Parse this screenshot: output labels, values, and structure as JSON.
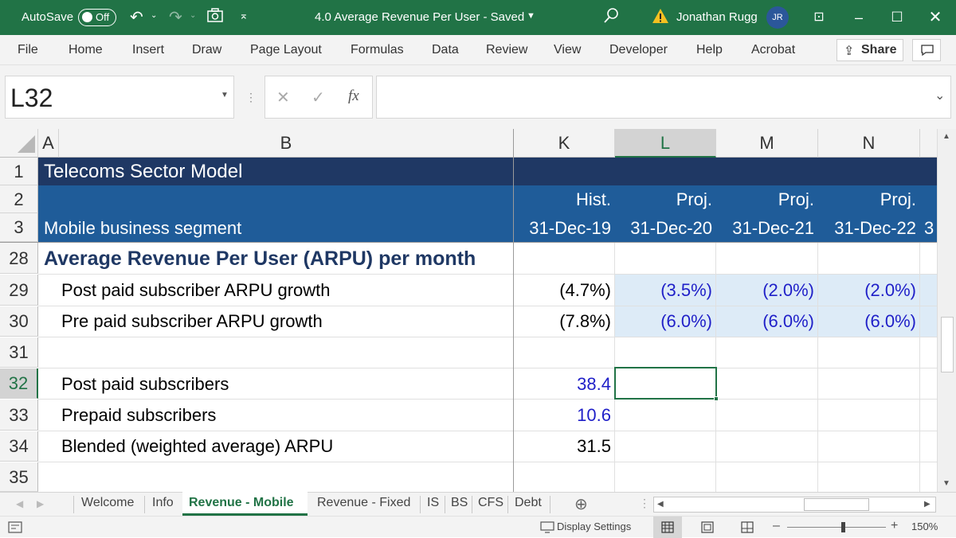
{
  "titlebar": {
    "autosave_label": "AutoSave",
    "autosave_state": "Off",
    "doc_title": "4.0 Average Revenue Per User  -  Saved",
    "user_name": "Jonathan Rugg",
    "user_initials": "JR",
    "accent": "#217346"
  },
  "ribbon": {
    "tabs": [
      "File",
      "Home",
      "Insert",
      "Draw",
      "Page Layout",
      "Formulas",
      "Data",
      "Review",
      "View",
      "Developer",
      "Help",
      "Acrobat"
    ],
    "share_label": "Share"
  },
  "formula_bar": {
    "name_box": "L32",
    "fx_label": "fx",
    "formula": ""
  },
  "grid": {
    "columns": [
      "A",
      "B",
      "K",
      "L",
      "M",
      "N"
    ],
    "selected_column": "L",
    "selected_row": "32",
    "rows": [
      {
        "num": "1",
        "b": "Telecoms Sector Model",
        "k": "",
        "l": "",
        "m": "",
        "n": ""
      },
      {
        "num": "2",
        "b": "",
        "k": "Hist.",
        "l": "Proj.",
        "m": "Proj.",
        "n": "Proj."
      },
      {
        "num": "3",
        "b": "Mobile business segment",
        "k": "31-Dec-19",
        "l": "31-Dec-20",
        "m": "31-Dec-21",
        "n": "31-Dec-22",
        "extra": "3"
      },
      {
        "num": "28",
        "b": "Average Revenue Per User (ARPU) per month",
        "k": "",
        "l": "",
        "m": "",
        "n": ""
      },
      {
        "num": "29",
        "b": "Post paid subscriber ARPU growth",
        "k": "(4.7%)",
        "l": "(3.5%)",
        "m": "(2.0%)",
        "n": "(2.0%)"
      },
      {
        "num": "30",
        "b": "Pre paid subscriber ARPU growth",
        "k": "(7.8%)",
        "l": "(6.0%)",
        "m": "(6.0%)",
        "n": "(6.0%)"
      },
      {
        "num": "31",
        "b": "",
        "k": "",
        "l": "",
        "m": "",
        "n": ""
      },
      {
        "num": "32",
        "b": "Post paid subscribers",
        "k": "38.4",
        "l": "",
        "m": "",
        "n": ""
      },
      {
        "num": "33",
        "b": "Prepaid subscribers",
        "k": "10.6",
        "l": "",
        "m": "",
        "n": ""
      },
      {
        "num": "34",
        "b": "Blended (weighted average) ARPU",
        "k": "31.5",
        "l": "",
        "m": "",
        "n": ""
      },
      {
        "num": "35",
        "b": "",
        "k": "",
        "l": "",
        "m": "",
        "n": ""
      }
    ],
    "colors": {
      "title_band": "#1f3864",
      "header_band": "#1f5c99",
      "projection_fill": "#ddebf7",
      "input_blue": "#1f1fc8",
      "section_heading": "#1f3864"
    }
  },
  "sheet_tabs": {
    "tabs": [
      "Welcome",
      "Info",
      "Revenue - Mobile",
      "Revenue - Fixed",
      "IS",
      "BS",
      "CFS",
      "Debt"
    ],
    "active": "Revenue - Mobile"
  },
  "status_bar": {
    "display_settings": "Display Settings",
    "zoom": "150%"
  }
}
